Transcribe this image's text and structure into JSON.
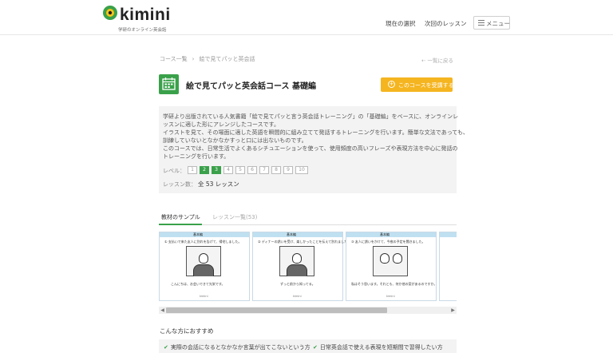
{
  "header": {
    "logo_text": "kimini",
    "logo_sub": "学研のオンライン英会話",
    "nav_current": "現在の選択",
    "nav_next": "次回のレッスン",
    "menu_label": "メニュー"
  },
  "breadcrumb": {
    "items": [
      "コース一覧",
      "絵で見てパッと英会話"
    ],
    "separator": "›",
    "back": "⇠ 一覧に戻る"
  },
  "course": {
    "title": "絵で見てパッと英会話コース 基礎編",
    "favorite_button": "このコースを受講する",
    "description": [
      "学研より出版されている人気書籍「絵で見てパッと言う英会話トレーニング」の「基礎編」をベースに、オンラインレ",
      "ッスンに適した形にアレンジしたコースです。",
      "イラストを見て、その場面に適した英語を瞬間的に組み立てて発話するトレーニングを行います。簡単な文法であっても、",
      "訓練していないとなかなかすっと口には出ないものです。",
      "このコースでは、日常生活でよくあるシチュエーションを使って、使用頻度の高いフレーズや表現方法を中心に発話の",
      "トレーニングを行います。"
    ],
    "level_label": "レベル：",
    "levels": [
      "1",
      "2",
      "3",
      "4",
      "5",
      "6",
      "7",
      "8",
      "9",
      "10"
    ],
    "active_levels": [
      "2",
      "3"
    ],
    "lessons_label": "レッスン数：",
    "lessons_count": "全 53 レッスン"
  },
  "tabs": {
    "sample": "教材のサンプル",
    "list": "レッスン一覧(53)"
  },
  "slides": [
    {
      "bar": "基本編",
      "question": "① 支払いで来た友人に別れを告げて、帰宅しました。",
      "answer": "こんにちは、お会いできて光栄です。",
      "foot": "kimini"
    },
    {
      "bar": "基本編",
      "question": "② ディナーの誘いを受け、楽しかったことを伝えて別れました。",
      "answer": "ずっと前から知ってる。",
      "foot": "kimini"
    },
    {
      "bar": "基本編",
      "question": "③ 友人に誘いをかけて、今夜の予定を聞きました。",
      "answer": "私はそう思います。それとも、何か他の案があるのですか。",
      "foot": "kimini"
    }
  ],
  "scroll": {
    "left": "◀",
    "right": "▶",
    "position": 0.78
  },
  "recommend": {
    "title": "こんな方におすすめ",
    "items": [
      "実際の会話になるとなかなか言葉が出てこないという方",
      "日常英会話で使える表現を短期間で習得したい方"
    ]
  },
  "colors": {
    "accent_green": "#3aa14a",
    "button_orange": "#f5b520",
    "panel_gray": "#f3f3f3"
  }
}
